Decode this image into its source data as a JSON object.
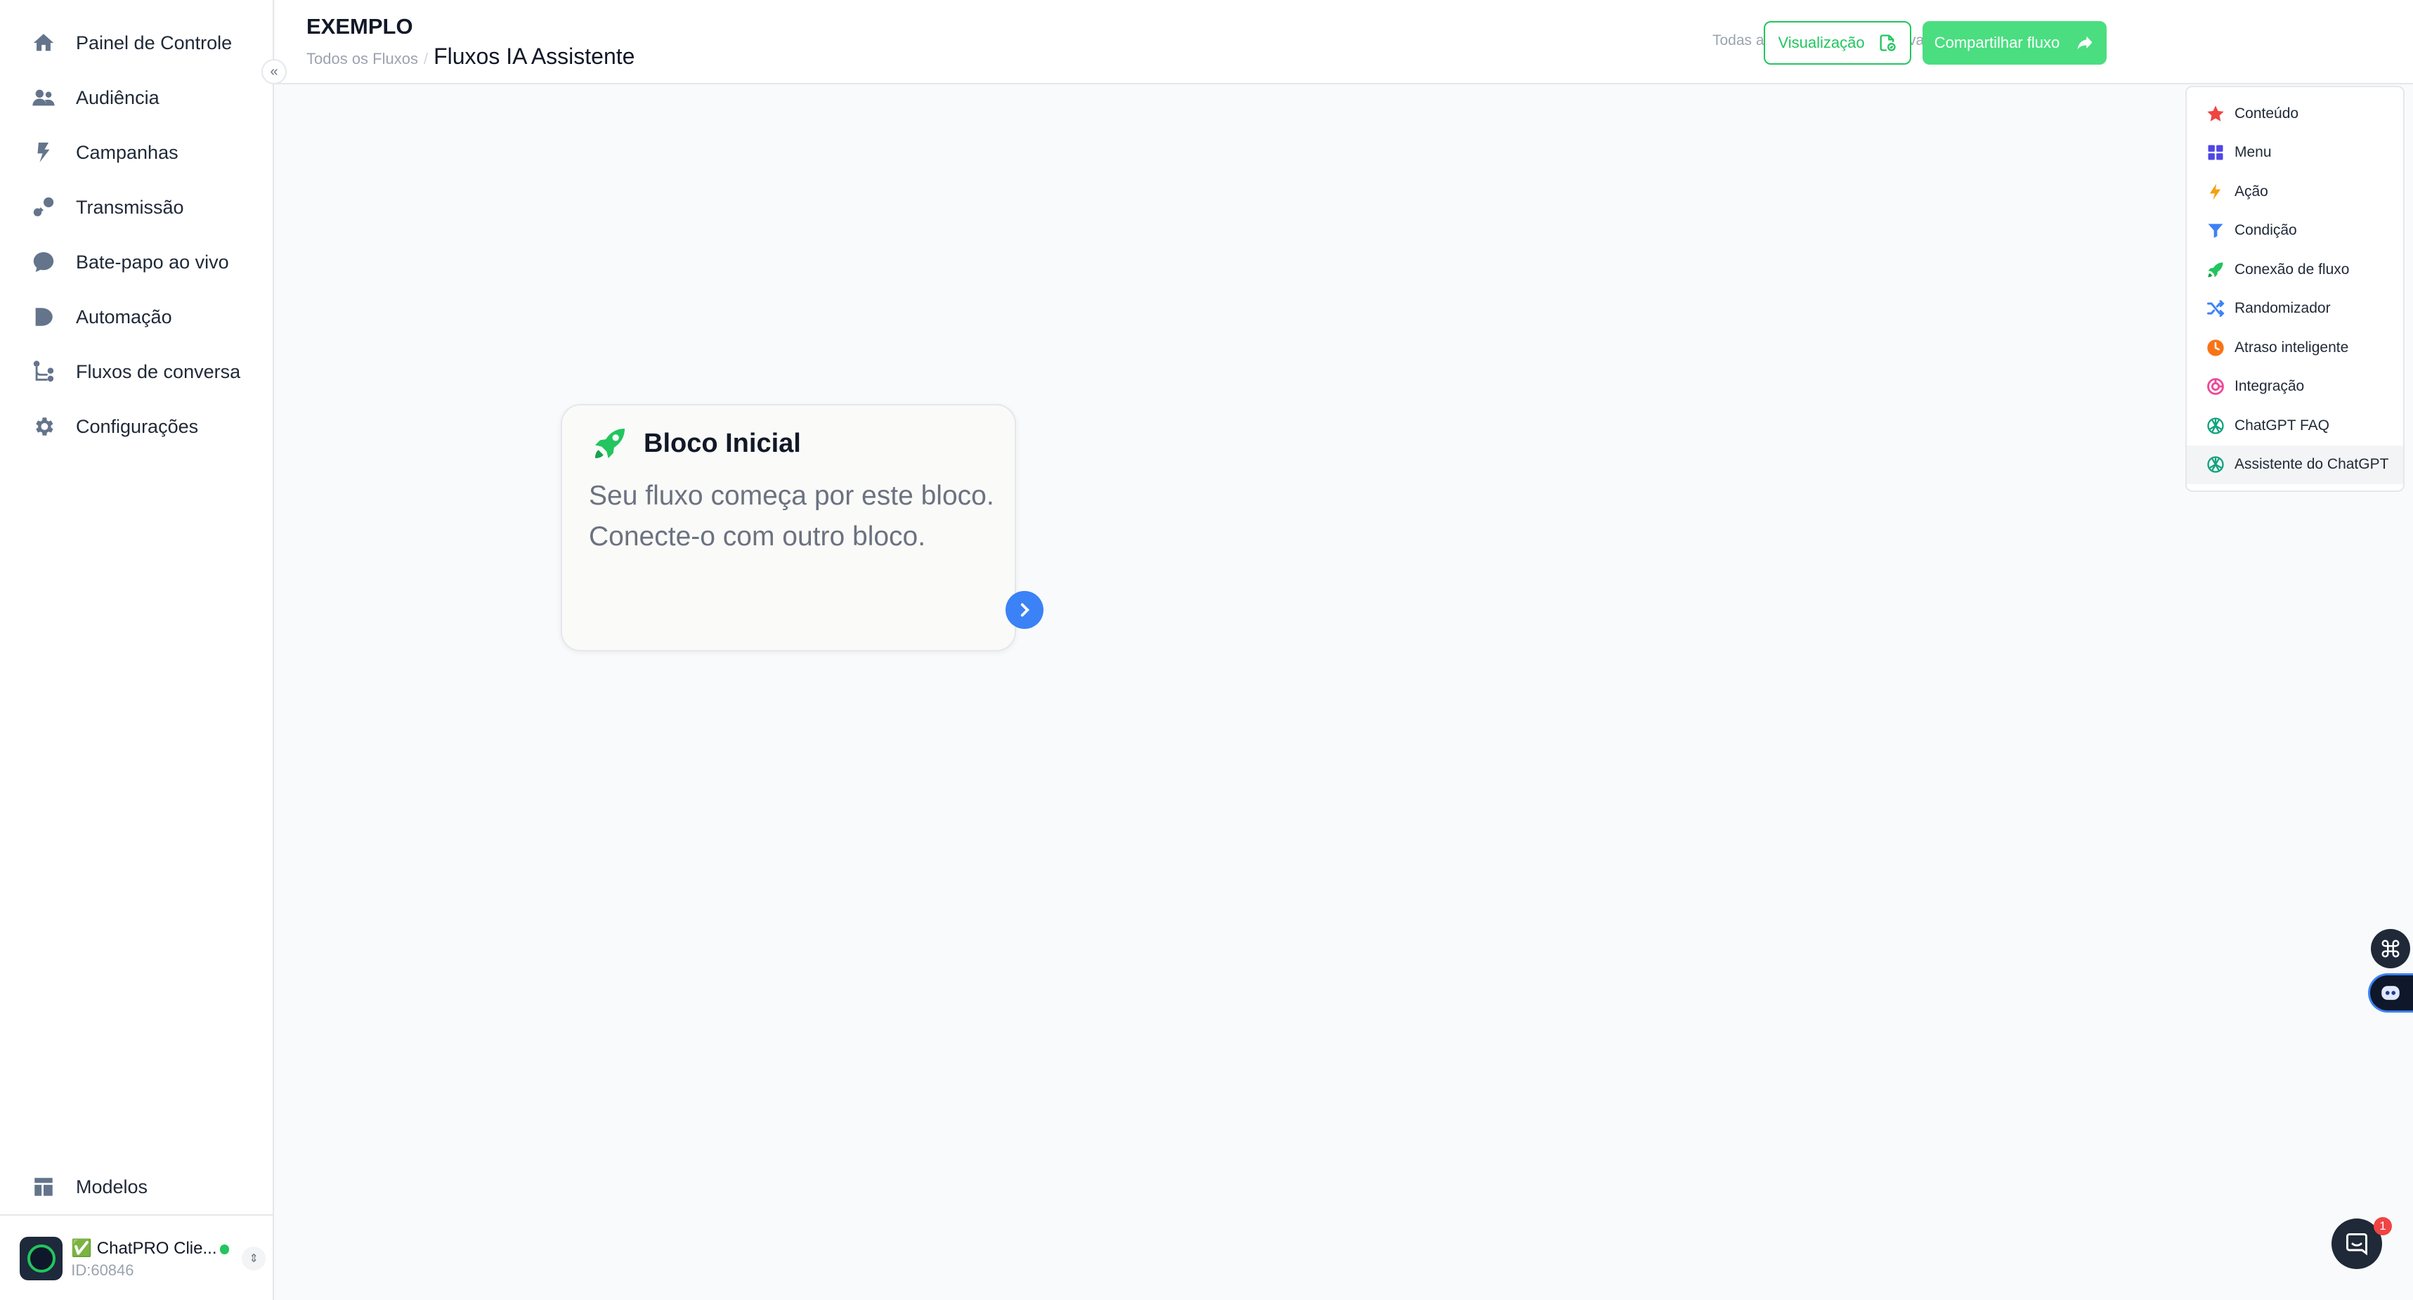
{
  "sidebar": {
    "items": [
      {
        "label": "Painel de Controle",
        "icon": "home-icon"
      },
      {
        "label": "Audiência",
        "icon": "users-icon"
      },
      {
        "label": "Campanhas",
        "icon": "bolt-icon"
      },
      {
        "label": "Transmissão",
        "icon": "broadcast-icon"
      },
      {
        "label": "Bate-papo ao vivo",
        "icon": "chat-icon"
      },
      {
        "label": "Automação",
        "icon": "automation-icon"
      },
      {
        "label": "Fluxos de conversa",
        "icon": "flow-icon"
      },
      {
        "label": "Configurações",
        "icon": "gear-icon"
      }
    ],
    "bottom": {
      "label": "Modelos",
      "icon": "templates-icon"
    },
    "account": {
      "name": "✅ ChatPRO Clie...",
      "id": "ID:60846",
      "status_color": "#22c55e"
    }
  },
  "header": {
    "title": "EXEMPLO",
    "breadcrumb_link": "Todos os Fluxos",
    "breadcrumb_sep": "/",
    "breadcrumb_current": "Fluxos IA Assistente",
    "autosave": "Todas as alterações foram salvas automaticamente",
    "preview_label": "Visualização",
    "share_label": "Compartilhar fluxo"
  },
  "canvas": {
    "start_block": {
      "title": "Bloco Inicial",
      "description": "Seu fluxo começa por este bloco. Conecte-o com outro bloco."
    }
  },
  "block_menu": {
    "items": [
      {
        "label": "Conteúdo",
        "icon": "star-icon",
        "color": "#ef4444"
      },
      {
        "label": "Menu",
        "icon": "grid-icon",
        "color": "#4f46e5"
      },
      {
        "label": "Ação",
        "icon": "lightning-icon",
        "color": "#f59e0b"
      },
      {
        "label": "Condição",
        "icon": "filter-icon",
        "color": "#3b82f6"
      },
      {
        "label": "Conexão de fluxo",
        "icon": "rocket-icon",
        "color": "#22c55e"
      },
      {
        "label": "Randomizador",
        "icon": "shuffle-icon",
        "color": "#3b82f6"
      },
      {
        "label": "Atraso inteligente",
        "icon": "clock-icon",
        "color": "#f97316"
      },
      {
        "label": "Integração",
        "icon": "integration-icon",
        "color": "#ec4899"
      },
      {
        "label": "ChatGPT FAQ",
        "icon": "openai-icon",
        "color": "#10a37f"
      },
      {
        "label": "Assistente do ChatGPT",
        "icon": "openai-icon",
        "color": "#10a37f"
      }
    ]
  },
  "chat_widget": {
    "badge": "1"
  },
  "colors": {
    "accent": "#22c55e",
    "connector": "#3b82f6"
  }
}
